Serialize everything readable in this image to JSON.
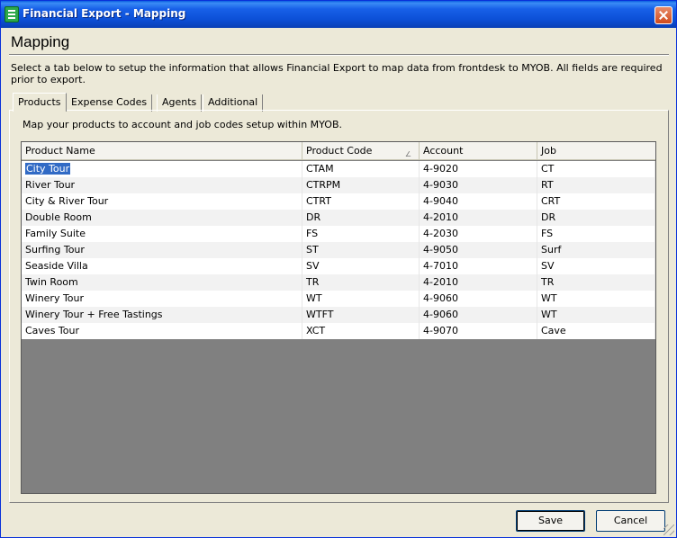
{
  "window": {
    "title": "Financial Export - Mapping",
    "app_icon": "financial-export-icon",
    "close_icon": "close-icon"
  },
  "page": {
    "heading": "Mapping",
    "instructions": "Select a tab below to setup the information that allows Financial Export to map data from frontdesk to MYOB.  All fields are required prior to export."
  },
  "tabs": [
    {
      "label": "Products",
      "active": true
    },
    {
      "label": "Expense Codes",
      "active": false
    },
    {
      "label": "Agents",
      "active": false
    },
    {
      "label": "Additional",
      "active": false
    }
  ],
  "products_panel": {
    "description": "Map your products to account and job codes setup within MYOB.",
    "columns": [
      "Product Name",
      "Product Code",
      "Account",
      "Job"
    ],
    "sort_column": "Product Code",
    "sort_icon": "sort-ascending-icon",
    "rows": [
      {
        "name": "City Tour",
        "code": "CTAM",
        "account": "4-9020",
        "job": "CT"
      },
      {
        "name": "River Tour",
        "code": "CTRPM",
        "account": "4-9030",
        "job": "RT"
      },
      {
        "name": "City & River Tour",
        "code": "CTRT",
        "account": "4-9040",
        "job": "CRT"
      },
      {
        "name": "Double Room",
        "code": "DR",
        "account": "4-2010",
        "job": "DR"
      },
      {
        "name": "Family Suite",
        "code": "FS",
        "account": "4-2030",
        "job": "FS"
      },
      {
        "name": "Surfing Tour",
        "code": "ST",
        "account": "4-9050",
        "job": "Surf"
      },
      {
        "name": "Seaside Villa",
        "code": "SV",
        "account": "4-7010",
        "job": "SV"
      },
      {
        "name": "Twin Room",
        "code": "TR",
        "account": "4-2010",
        "job": "TR"
      },
      {
        "name": "Winery Tour",
        "code": "WT",
        "account": "4-9060",
        "job": "WT"
      },
      {
        "name": "Winery Tour + Free Tastings",
        "code": "WTFT",
        "account": "4-9060",
        "job": "WT"
      },
      {
        "name": "Caves Tour",
        "code": "XCT",
        "account": "4-9070",
        "job": "Cave"
      }
    ]
  },
  "buttons": {
    "save": "Save",
    "cancel": "Cancel"
  }
}
